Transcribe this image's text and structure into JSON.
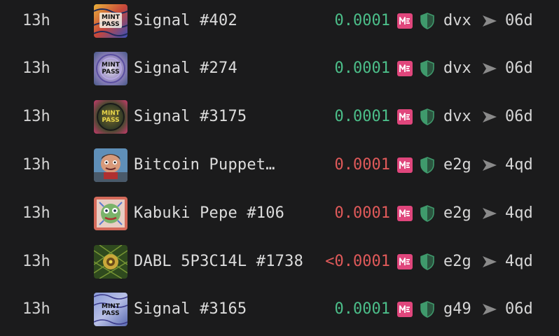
{
  "colors": {
    "background": "#1b1b1c",
    "price_up": "#4cbf8a",
    "price_down": "#e05a5a",
    "marketplace_badge": "#e0467c",
    "shield": "#3f9a6c",
    "arrow": "#8a8a8a"
  },
  "rows": [
    {
      "time": "13h",
      "thumb": "mint-pass",
      "name": "Signal #402",
      "price": "0.0001",
      "direction": "up",
      "from": "dvx",
      "to": "06d"
    },
    {
      "time": "13h",
      "thumb": "mint-pass",
      "name": "Signal #274",
      "price": "0.0001",
      "direction": "up",
      "from": "dvx",
      "to": "06d"
    },
    {
      "time": "13h",
      "thumb": "mint-pass",
      "name": "Signal #3175",
      "price": "0.0001",
      "direction": "up",
      "from": "dvx",
      "to": "06d"
    },
    {
      "time": "13h",
      "thumb": "puppet",
      "name": "Bitcoin Puppet…",
      "price": "0.0001",
      "direction": "down",
      "from": "e2g",
      "to": "4qd"
    },
    {
      "time": "13h",
      "thumb": "pepe",
      "name": "Kabuki Pepe #106",
      "price": "0.0001",
      "direction": "down",
      "from": "e2g",
      "to": "4qd"
    },
    {
      "time": "13h",
      "thumb": "dabl",
      "name": "DABL 5P3C14L #1738",
      "price": "<0.0001",
      "direction": "down",
      "from": "e2g",
      "to": "4qd"
    },
    {
      "time": "13h",
      "thumb": "mint-pass",
      "name": "Signal #3165",
      "price": "0.0001",
      "direction": "up",
      "from": "g49",
      "to": "06d"
    }
  ],
  "icons": {
    "marketplace": "magic-eden-icon",
    "verified": "shield-icon",
    "transfer": "arrow-right-icon"
  }
}
